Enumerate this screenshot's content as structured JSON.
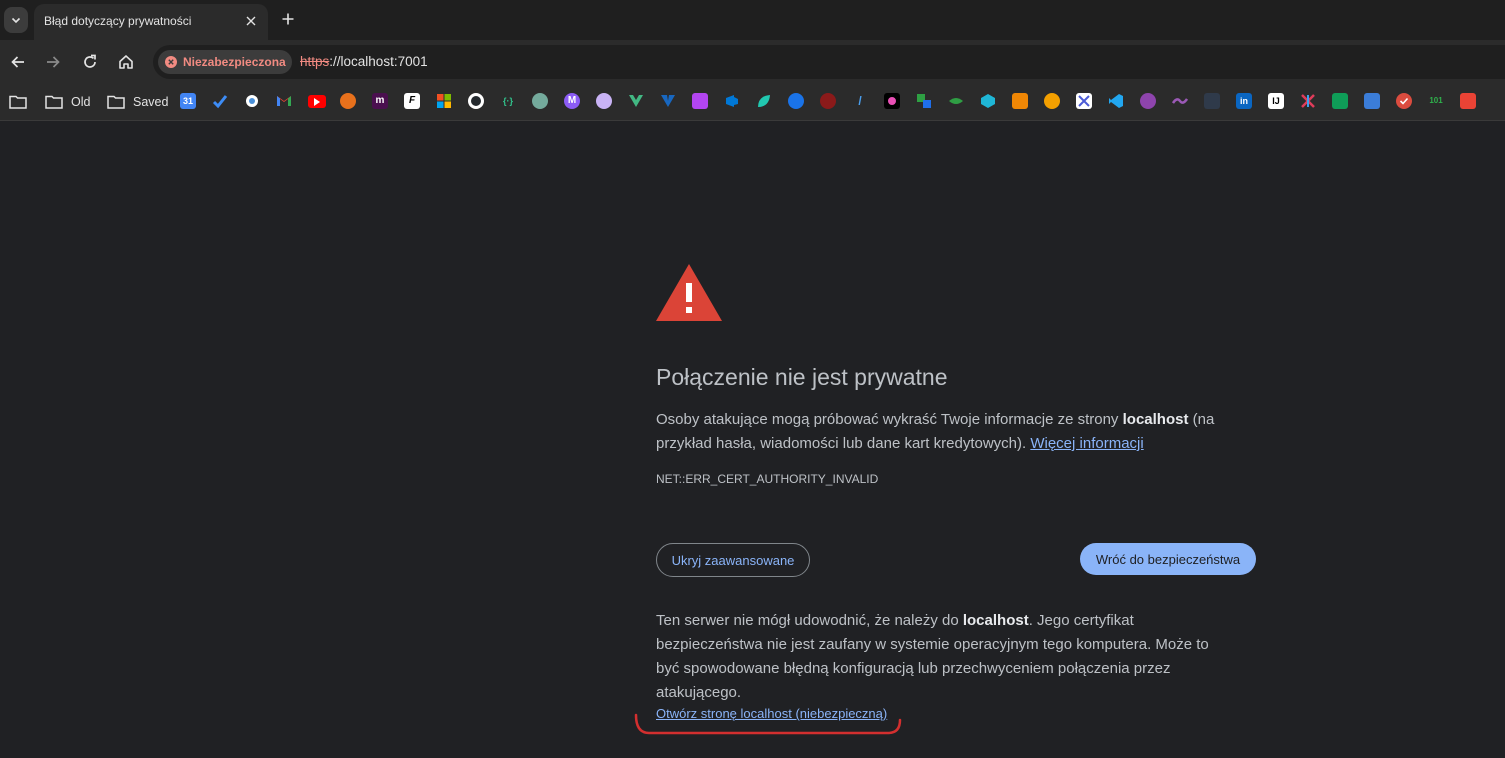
{
  "tab": {
    "title": "Błąd dotyczący prywatności"
  },
  "toolbar": {
    "security_label": "Niezabezpieczona",
    "url_scheme": "https",
    "url_rest": "://localhost:7001"
  },
  "bookmarks": {
    "folders": [
      "Old",
      "Saved"
    ],
    "calendar_badge": "31",
    "icons": [
      "empty-folder-icon",
      "old-folder-icon",
      "saved-folder-icon",
      "google-calendar-icon",
      "checkmark-icon",
      "circle-app-icon",
      "gmail-icon",
      "youtube-icon",
      "basketball-icon",
      "m-app-icon",
      "f-app-icon",
      "microsoft-icon",
      "github-icon",
      "code-brackets-icon",
      "chatgpt-icon",
      "mastodon-icon",
      "swirl-icon",
      "vue-icon",
      "vuetify-icon",
      "phpstorm-icon",
      "azure-devops-icon",
      "leaf-icon",
      "blue-circle-icon",
      "skull-icon",
      "slash-icon",
      "colorful-star-icon",
      "green-boxes-icon",
      "green-bird-icon",
      "teal-cube-icon",
      "orange-blocks-icon",
      "orange-dots-icon",
      "tools-icon",
      "vscode-icon",
      "purple-badge-icon",
      "purple-wave-icon",
      "dark-icon",
      "linkedin-icon",
      "ij-icon",
      "pinwheel-icon",
      "green-sheet-icon",
      "blue-pen-icon",
      "red-check-icon",
      "green-numbers-icon",
      "red-doc-icon"
    ]
  },
  "interstitial": {
    "heading": "Połączenie nie jest prywatne",
    "p1_before": "Osoby atakujące mogą próbować wykraść Twoje informacje ze strony ",
    "p1_host": "localhost",
    "p1_after": " (na przykład hasła, wiadomości lub dane kart kredytowych). ",
    "learn_more": "Więcej informacji",
    "error_code": "NET::ERR_CERT_AUTHORITY_INVALID",
    "hide_advanced": "Ukryj zaawansowane",
    "back_to_safety": "Wróć do bezpieczeństwa",
    "p2_before": "Ten serwer nie mógł udowodnić, że należy do ",
    "p2_host": "localhost",
    "p2_after": ". Jego certyfikat bezpieczeństwa nie jest zaufany w systemie operacyjnym tego komputera. Może to być spowodowane błędną konfiguracją lub przechwyceniem połączenia przez atakującego.",
    "proceed_link": "Otwórz stronę localhost (niebezpieczną)"
  },
  "colors": {
    "background": "#202124",
    "accent": "#8ab4f8",
    "danger": "#f28b82",
    "warning_icon": "#db4437",
    "annotation": "#d32f2f"
  }
}
